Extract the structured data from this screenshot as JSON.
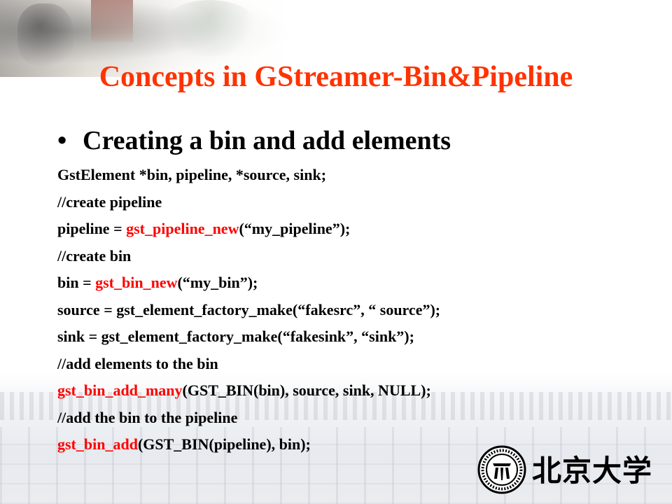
{
  "slide": {
    "title": "Concepts in GStreamer-Bin&Pipeline",
    "bullet": {
      "symbol": "•",
      "text": "Creating a bin and add elements"
    },
    "code_lines": [
      {
        "segments": [
          {
            "text": "GstElement *bin, pipeline, *source, sink;",
            "color": "#000000"
          }
        ]
      },
      {
        "segments": [
          {
            "text": "//create pipeline",
            "color": "#000000"
          }
        ]
      },
      {
        "segments": [
          {
            "text": "pipeline = ",
            "color": "#000000"
          },
          {
            "text": "gst_pipeline_new",
            "color": "#ff0000"
          },
          {
            "text": "(“my_pipeline”);",
            "color": "#000000"
          }
        ]
      },
      {
        "segments": [
          {
            "text": "//create bin",
            "color": "#000000"
          }
        ]
      },
      {
        "segments": [
          {
            "text": "bin = ",
            "color": "#000000"
          },
          {
            "text": "gst_bin_new",
            "color": "#ff0000"
          },
          {
            "text": "(“my_bin”);",
            "color": "#000000"
          }
        ]
      },
      {
        "segments": [
          {
            "text": "source = gst_element_factory_make(“fakesrc”, “ source”);",
            "color": "#000000"
          }
        ]
      },
      {
        "segments": [
          {
            "text": "sink = gst_element_factory_make(“fakesink”, “sink”);",
            "color": "#000000"
          }
        ]
      },
      {
        "segments": [
          {
            "text": "//add elements to the bin",
            "color": "#000000"
          }
        ]
      },
      {
        "segments": [
          {
            "text": "gst_bin_add_many",
            "color": "#ff0000"
          },
          {
            "text": "(GST_BIN(bin), source, sink, NULL);",
            "color": "#000000"
          }
        ]
      },
      {
        "segments": [
          {
            "text": "//add the bin to the pipeline",
            "color": "#000000"
          }
        ]
      },
      {
        "segments": [
          {
            "text": "gst_bin_add",
            "color": "#ff0000"
          },
          {
            "text": "(GST_BIN(pipeline), bin);",
            "color": "#000000"
          }
        ]
      }
    ],
    "logo": {
      "icon": "peking-university-seal-icon",
      "seal_text": "PEKING UNIVERSITY 1898",
      "calligraphy": "北京大学"
    }
  },
  "colors": {
    "title": "#ff3300",
    "highlight": "#ff0000",
    "text": "#000000"
  }
}
